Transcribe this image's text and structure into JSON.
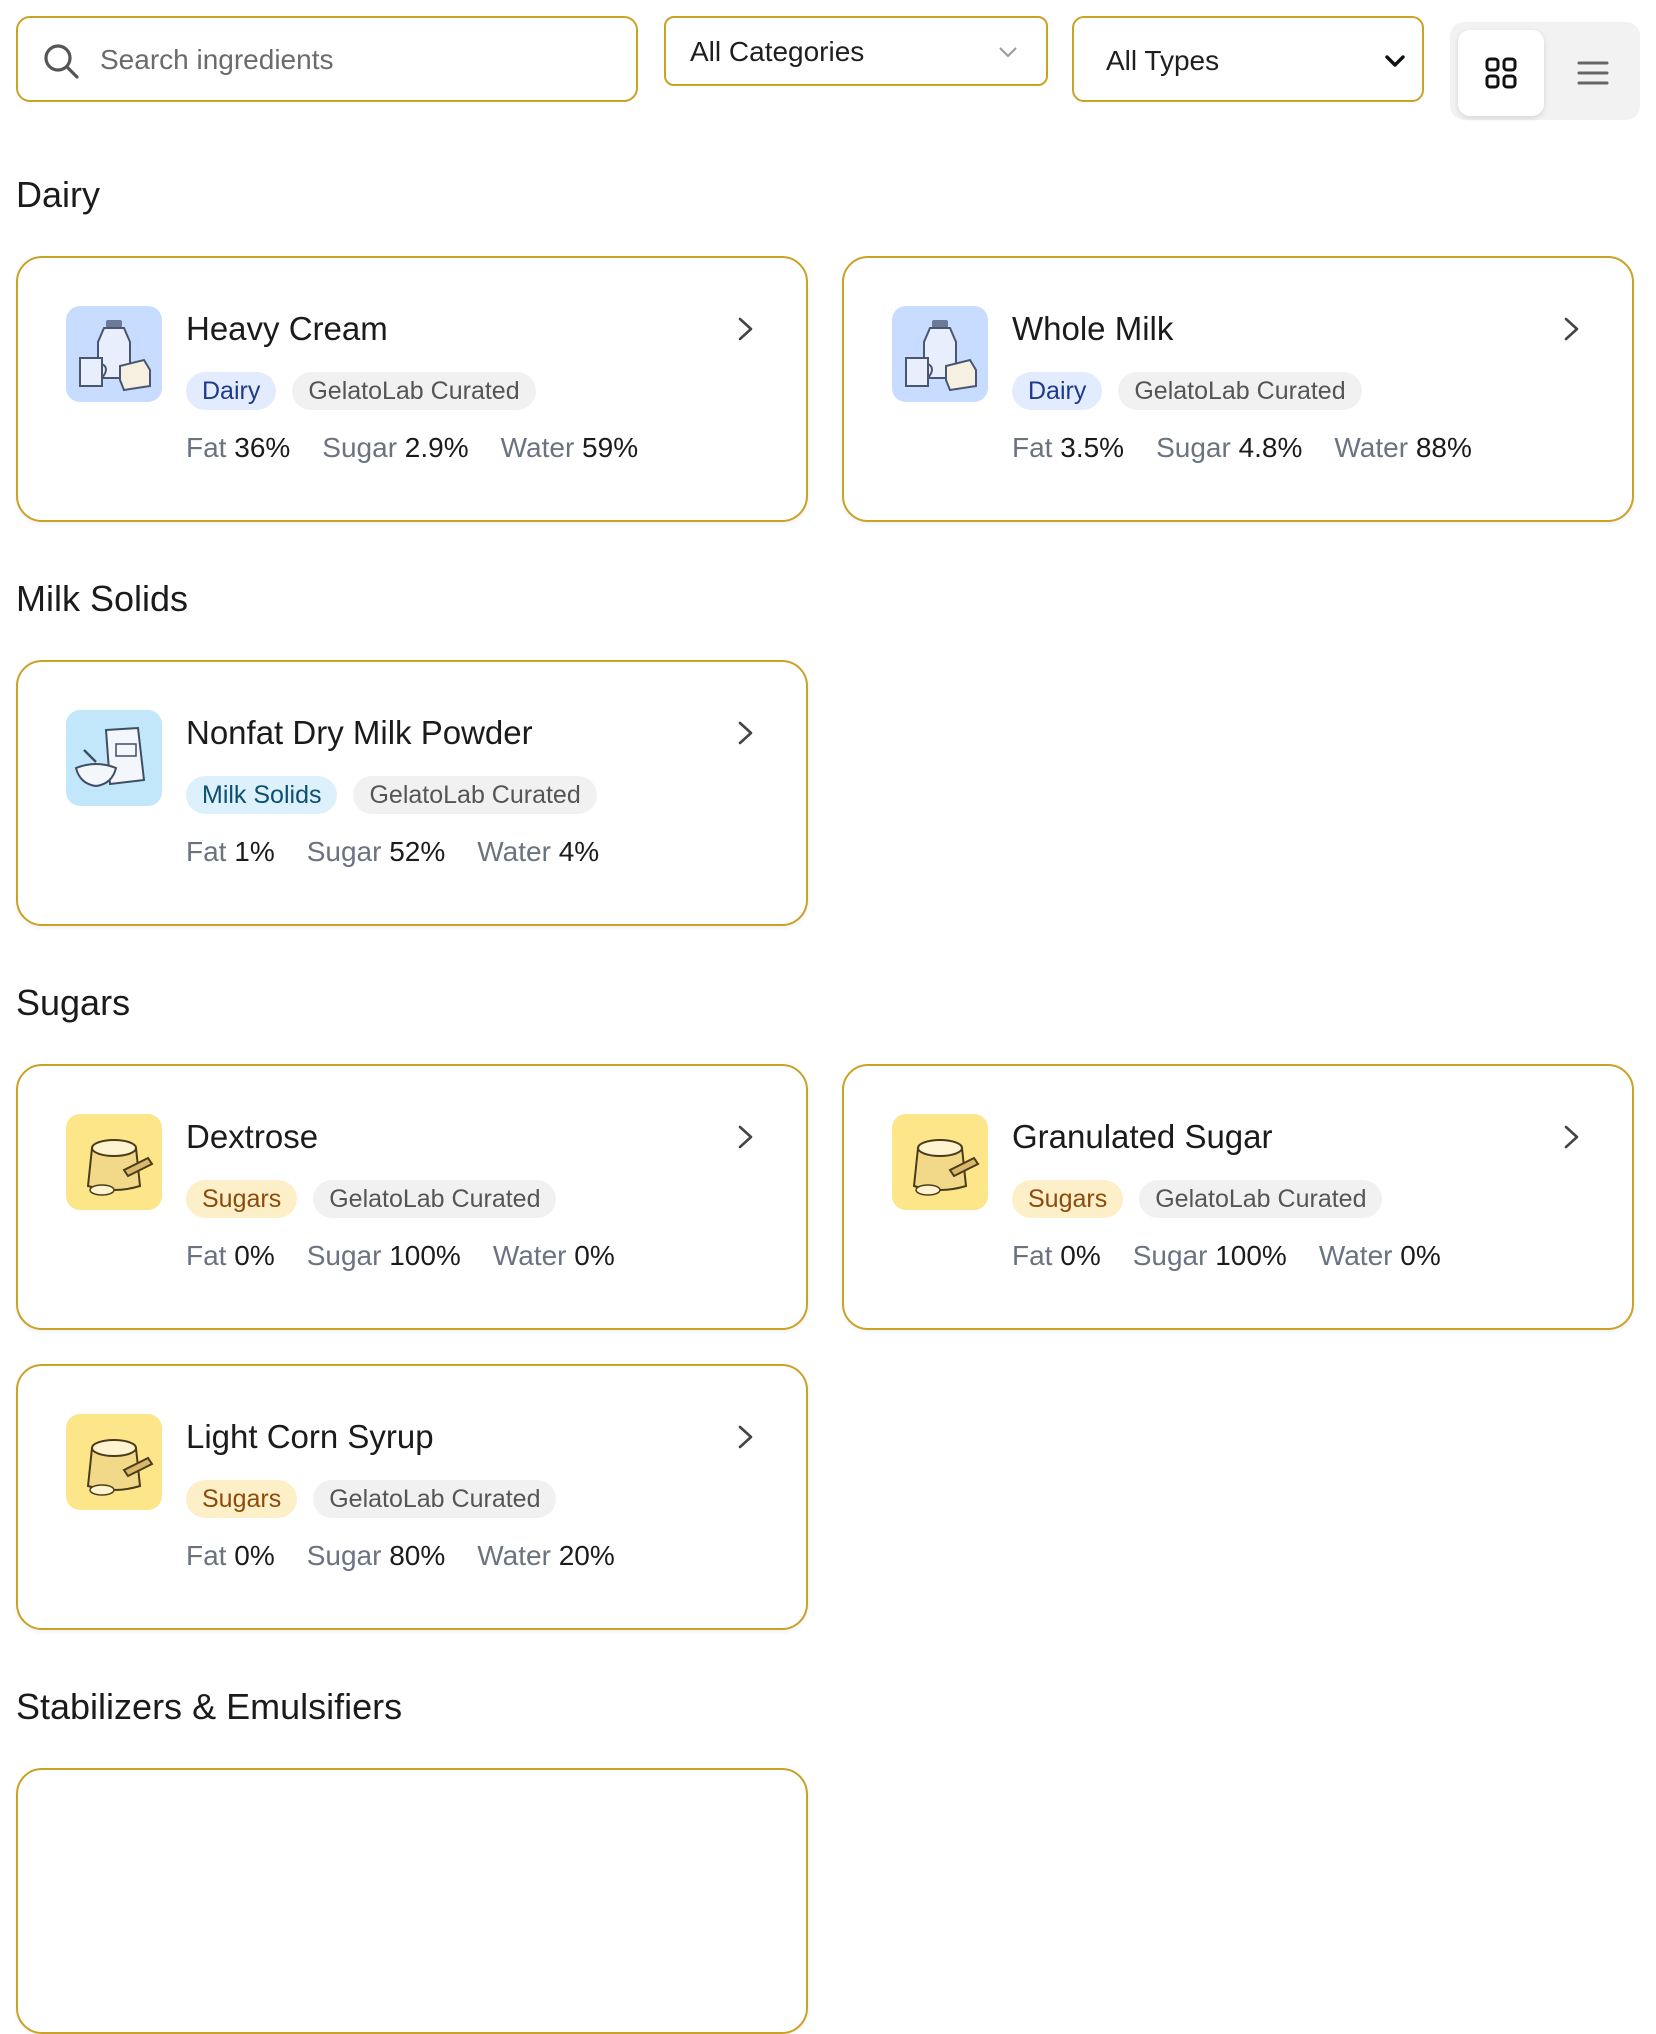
{
  "search": {
    "placeholder": "Search ingredients",
    "icon": "search-icon"
  },
  "filters": {
    "category": {
      "selected": "All Categories"
    },
    "type": {
      "selected": "All Types"
    }
  },
  "view_toggle": {
    "active": "grid",
    "options": [
      "grid",
      "list"
    ]
  },
  "colors": {
    "accent_border": "#c9a227",
    "dairy_tag": "#e3ecff",
    "milk_solids_tag": "#dcf1fb",
    "sugars_tag": "#fdf0c8",
    "curated_tag": "#f1f1f1"
  },
  "sections": [
    {
      "title": "Dairy",
      "items": [
        {
          "name": "Heavy Cream",
          "category": "Dairy",
          "source": "GelatoLab Curated",
          "fat_label": "Fat",
          "fat": "36%",
          "sugar_label": "Sugar",
          "sugar": "2.9%",
          "water_label": "Water",
          "water": "59%"
        },
        {
          "name": "Whole Milk",
          "category": "Dairy",
          "source": "GelatoLab Curated",
          "fat_label": "Fat",
          "fat": "3.5%",
          "sugar_label": "Sugar",
          "sugar": "4.8%",
          "water_label": "Water",
          "water": "88%"
        }
      ]
    },
    {
      "title": "Milk Solids",
      "items": [
        {
          "name": "Nonfat Dry Milk Powder",
          "category": "Milk Solids",
          "source": "GelatoLab Curated",
          "fat_label": "Fat",
          "fat": "1%",
          "sugar_label": "Sugar",
          "sugar": "52%",
          "water_label": "Water",
          "water": "4%"
        }
      ]
    },
    {
      "title": "Sugars",
      "items": [
        {
          "name": "Dextrose",
          "category": "Sugars",
          "source": "GelatoLab Curated",
          "fat_label": "Fat",
          "fat": "0%",
          "sugar_label": "Sugar",
          "sugar": "100%",
          "water_label": "Water",
          "water": "0%"
        },
        {
          "name": "Granulated Sugar",
          "category": "Sugars",
          "source": "GelatoLab Curated",
          "fat_label": "Fat",
          "fat": "0%",
          "sugar_label": "Sugar",
          "sugar": "100%",
          "water_label": "Water",
          "water": "0%"
        },
        {
          "name": "Light Corn Syrup",
          "category": "Sugars",
          "source": "GelatoLab Curated",
          "fat_label": "Fat",
          "fat": "0%",
          "sugar_label": "Sugar",
          "sugar": "80%",
          "water_label": "Water",
          "water": "20%"
        }
      ]
    },
    {
      "title": "Stabilizers & Emulsifiers",
      "items": []
    }
  ]
}
